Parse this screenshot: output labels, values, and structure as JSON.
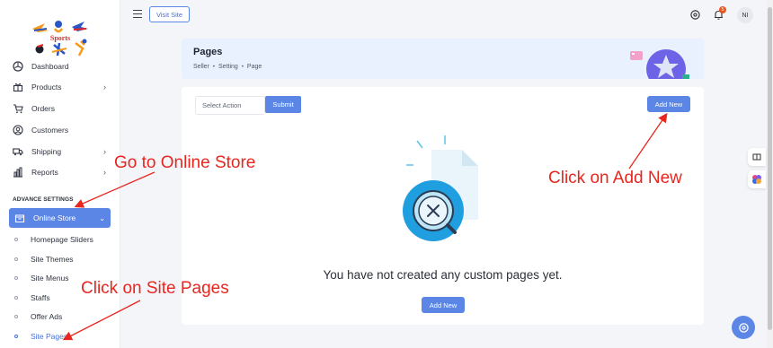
{
  "brand": {
    "logo_text": "Sports"
  },
  "sidebar": {
    "items": [
      {
        "label": "Dashboard",
        "icon": "dashboard-icon",
        "has_chevron": false
      },
      {
        "label": "Products",
        "icon": "gift-icon",
        "has_chevron": true
      },
      {
        "label": "Orders",
        "icon": "cart-icon",
        "has_chevron": false
      },
      {
        "label": "Customers",
        "icon": "customer-icon",
        "has_chevron": false
      },
      {
        "label": "Shipping",
        "icon": "truck-icon",
        "has_chevron": true
      },
      {
        "label": "Reports",
        "icon": "chart-icon",
        "has_chevron": true
      }
    ],
    "section_title": "ADVANCE SETTINGS",
    "active": {
      "label": "Online Store",
      "icon": "store-icon"
    },
    "sub_items": [
      {
        "label": "Homepage Sliders"
      },
      {
        "label": "Site Themes"
      },
      {
        "label": "Site Menus"
      },
      {
        "label": "Staffs"
      },
      {
        "label": "Offer Ads"
      },
      {
        "label": "Site Pages",
        "current": true
      }
    ]
  },
  "topbar": {
    "visit_site_label": "Visit Site",
    "notification_count": "5",
    "avatar_initials": "NI"
  },
  "header": {
    "title": "Pages",
    "breadcrumb": [
      "Seller",
      "Setting",
      "Page"
    ]
  },
  "content": {
    "select_action_placeholder": "Select Action",
    "submit_label": "Submit",
    "add_new_label": "Add New",
    "empty_message": "You have not created any custom pages yet.",
    "add_new_bottom_label": "Add New"
  },
  "annotations": {
    "go_online_store": "Go to Online Store",
    "click_add_new": "Click on Add New",
    "click_site_pages": "Click on Site Pages"
  },
  "colors": {
    "accent": "#5b86e5",
    "annotation": "#e8261f",
    "badge": "#e8551f"
  }
}
